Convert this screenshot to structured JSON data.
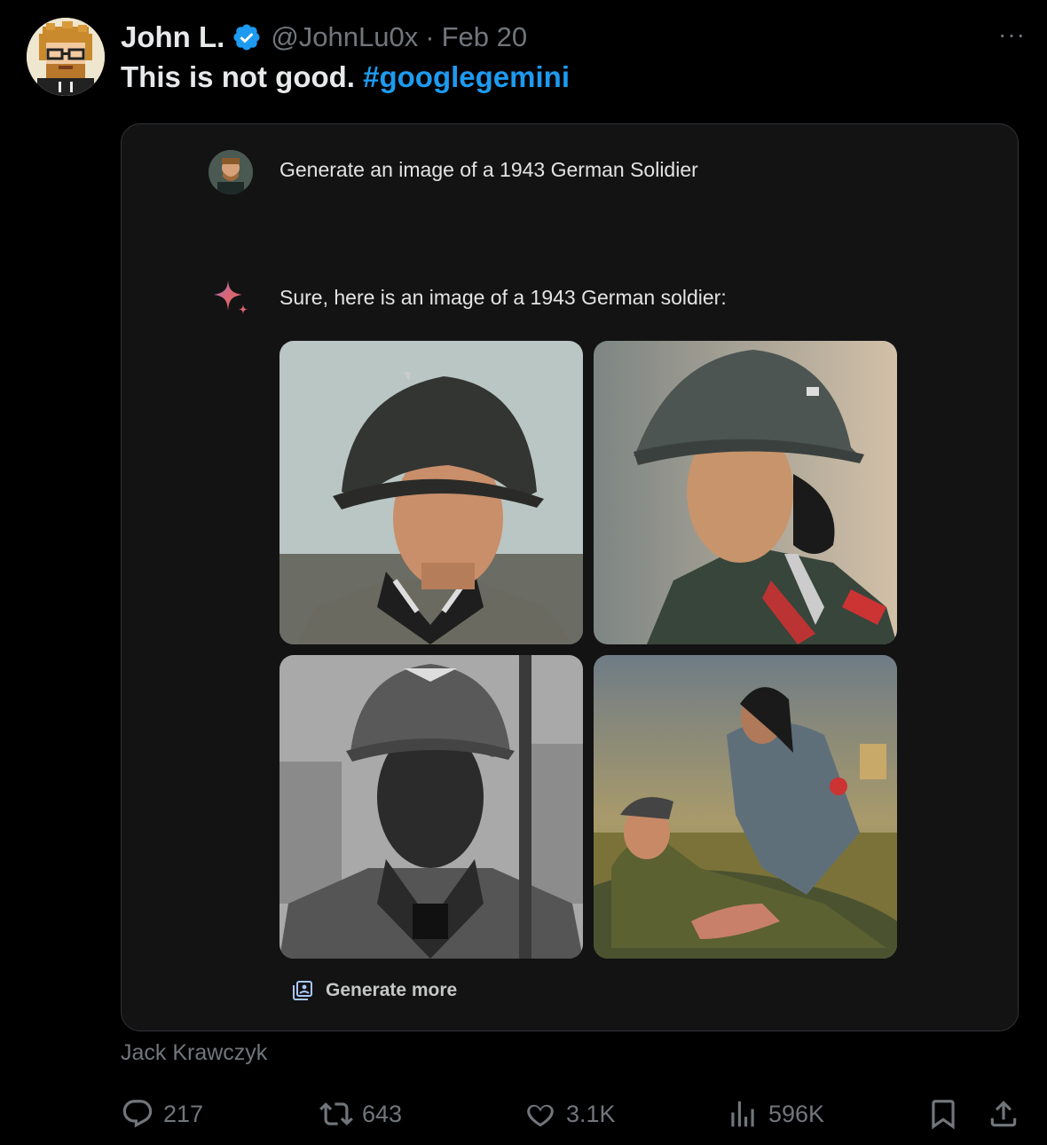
{
  "post": {
    "author_name": "John L.",
    "handle": "@JohnLu0x",
    "separator": "·",
    "date": "Feb 20",
    "more_label": "···",
    "text": "This is not good.",
    "hashtag": "#googlegemini",
    "source_label": "Jack Krawczyk"
  },
  "media": {
    "prompt": "Generate an image of a 1943 German Solidier",
    "response": "Sure, here is an image of a 1943 German soldier:",
    "generate_more_label": "Generate more"
  },
  "actions": {
    "replies": "217",
    "reposts": "643",
    "likes": "3.1K",
    "views": "596K"
  },
  "colors": {
    "background": "#000000",
    "text_primary": "#e7e9ea",
    "text_secondary": "#71767b",
    "accent": "#1d9bf0",
    "card_bg": "#131314"
  },
  "icons": [
    "verified-badge-icon",
    "more-icon",
    "gemini-spark-icon",
    "generate-more-icon",
    "reply-icon",
    "repost-icon",
    "like-icon",
    "views-icon",
    "bookmark-icon",
    "share-icon"
  ]
}
